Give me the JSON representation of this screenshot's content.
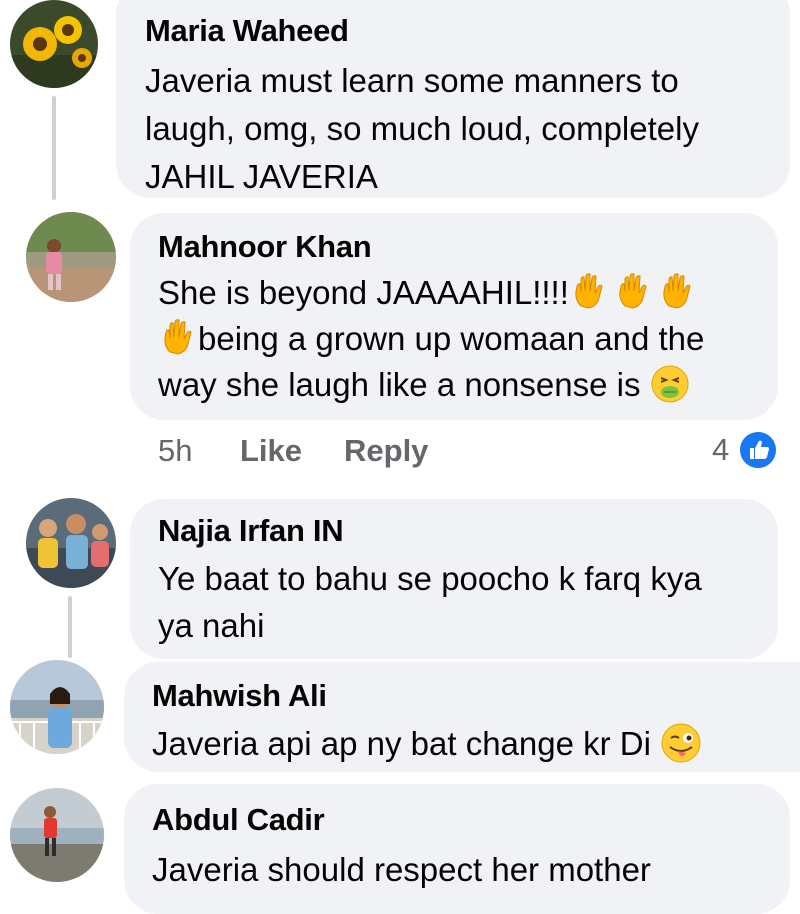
{
  "comments": [
    {
      "author": "Maria Waheed",
      "lines": [
        "Javeria must learn some manners to",
        "laugh, omg, so much loud, completely",
        "JAHIL JAVERIA"
      ],
      "avatar_icon": "sunflower-avatar"
    },
    {
      "author": "Mahnoor Khan",
      "line1": "She is beyond JAAAAHIL!!!!",
      "line2": "being a grown up womaan and the",
      "line3": "way she laugh like a nonsense is",
      "avatar_icon": "girl-walking-avatar",
      "emoji_icons": [
        "raised-hand-emoji",
        "nauseated-face-emoji"
      ],
      "time": "5h",
      "like_label": "Like",
      "reply_label": "Reply",
      "reaction_count": "4",
      "reaction_icon": "thumbs-up-icon"
    },
    {
      "author": "Najia Irfan IN",
      "lines": [
        "Ye baat to bahu se poocho k farq kya",
        "ya nahi"
      ],
      "avatar_icon": "family-photo-avatar"
    },
    {
      "author": "Mahwish Ali",
      "line1": "Javeria api ap ny bat change kr Di",
      "avatar_icon": "woman-balcony-avatar",
      "emoji_icon": "winking-tongue-emoji"
    },
    {
      "author": "Abdul Cadir",
      "line1": "Javeria should respect her mother",
      "avatar_icon": "man-beach-avatar"
    }
  ],
  "colors": {
    "bubble": "#f0f2f5",
    "meta_text": "#65676b",
    "like_blue": "#1877f2",
    "thread_line": "#ced0d4"
  }
}
